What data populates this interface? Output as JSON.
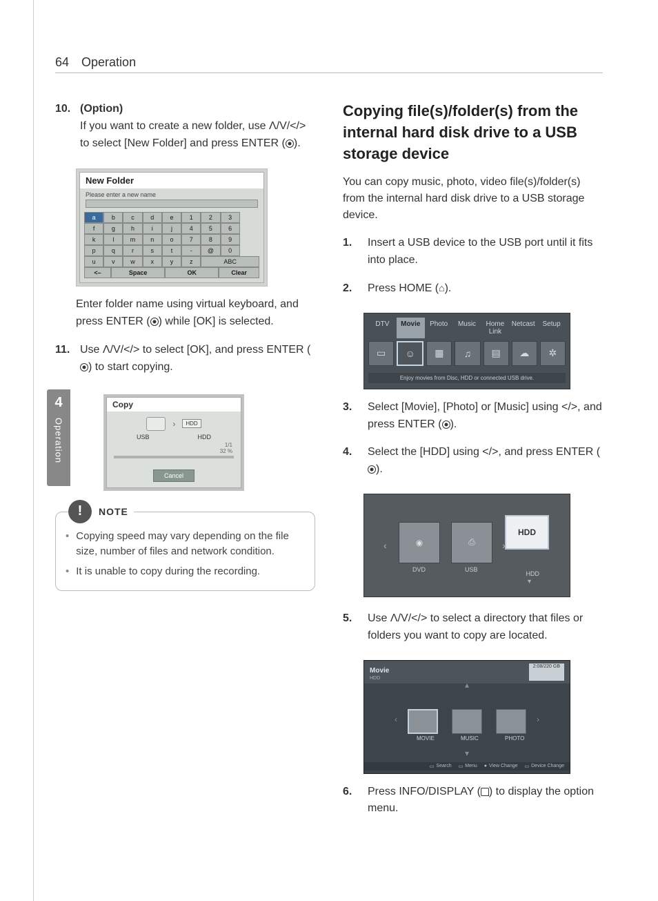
{
  "header": {
    "page_number": "64",
    "section": "Operation"
  },
  "sidebar": {
    "chapter_number": "4",
    "chapter_label": "Operation"
  },
  "left": {
    "step10": {
      "number": "10.",
      "title": "(Option)",
      "body_pre": "If you want to create a new folder, use ",
      "nav": "Λ/V/</>",
      "body_mid": " to select [New Folder] and press ENTER (",
      "body_post": ")."
    },
    "vk": {
      "title": "New Folder",
      "prompt": "Please enter a new name",
      "rows": [
        [
          "a",
          "b",
          "c",
          "d",
          "e",
          "1",
          "2",
          "3"
        ],
        [
          "f",
          "g",
          "h",
          "i",
          "j",
          "4",
          "5",
          "6"
        ],
        [
          "k",
          "l",
          "m",
          "n",
          "o",
          "7",
          "8",
          "9"
        ],
        [
          "p",
          "q",
          "r",
          "s",
          "t",
          "-",
          "@",
          "0"
        ],
        [
          "u",
          "v",
          "w",
          "x",
          "y",
          "z",
          "ABC",
          ""
        ]
      ],
      "bottom": {
        "back": "<–",
        "space": "Space",
        "ok": "OK",
        "clear": "Clear"
      }
    },
    "after_vk": "Enter folder name using virtual keyboard, and press ENTER (",
    "after_vk2": ") while [OK] is selected.",
    "step11": {
      "number": "11.",
      "pre": "Use ",
      "nav": "Λ/V/</>",
      "mid": " to select [OK], and press ENTER (",
      "post": ") to start copying."
    },
    "copy": {
      "title": "Copy",
      "src": "USB",
      "dst": "HDD",
      "dst_badge": "HDD",
      "progress_a": "1/1",
      "progress_b": "32 %",
      "cancel": "Cancel"
    },
    "note": {
      "label": "NOTE",
      "items": [
        "Copying speed may vary depending on the file size, number of files and network condition.",
        "It is unable to copy during the recording."
      ]
    }
  },
  "right": {
    "heading": "Copying file(s)/folder(s) from the internal hard disk drive to a USB storage device",
    "intro": "You can copy music, photo, video file(s)/folder(s) from the internal hard disk drive to a USB storage device.",
    "s1": {
      "n": "1.",
      "t": "Insert a USB device to the USB port until it fits into place."
    },
    "s2": {
      "n": "2.",
      "pre": "Press HOME (",
      "post": ")."
    },
    "home": {
      "tabs": [
        "DTV",
        "Movie",
        "Photo",
        "Music",
        "Home Link",
        "Netcast",
        "Setup"
      ],
      "active_tab": "Movie",
      "footer": "Enjoy movies from Disc, HDD or connected USB drive."
    },
    "s3": {
      "n": "3.",
      "pre": "Select [Movie], [Photo] or [Music] using ",
      "nav": "</>",
      "mid": ", and press ENTER (",
      "post": ")."
    },
    "s4": {
      "n": "4.",
      "pre": "Select the [HDD] using ",
      "nav": "</>",
      "mid": ", and press ENTER (",
      "post": ")."
    },
    "dev": {
      "dvd": "DVD",
      "usb": "USB",
      "hdd": "HDD",
      "hdd_label": "HDD"
    },
    "s5": {
      "n": "5.",
      "pre": "Use ",
      "nav": "Λ/V/</>",
      "post": " to select a directory that files or folders you want to copy are located."
    },
    "mov": {
      "title": "Movie",
      "sub": "HDD",
      "time": "2:08/220 GB",
      "folders": [
        "MOVIE",
        "MUSIC",
        "PHOTO"
      ],
      "footer": [
        "Search",
        "Menu",
        "View Change",
        "Device Change"
      ]
    },
    "s6": {
      "n": "6.",
      "pre": "Press INFO/DISPLAY (",
      "post": ") to display the option menu."
    }
  }
}
